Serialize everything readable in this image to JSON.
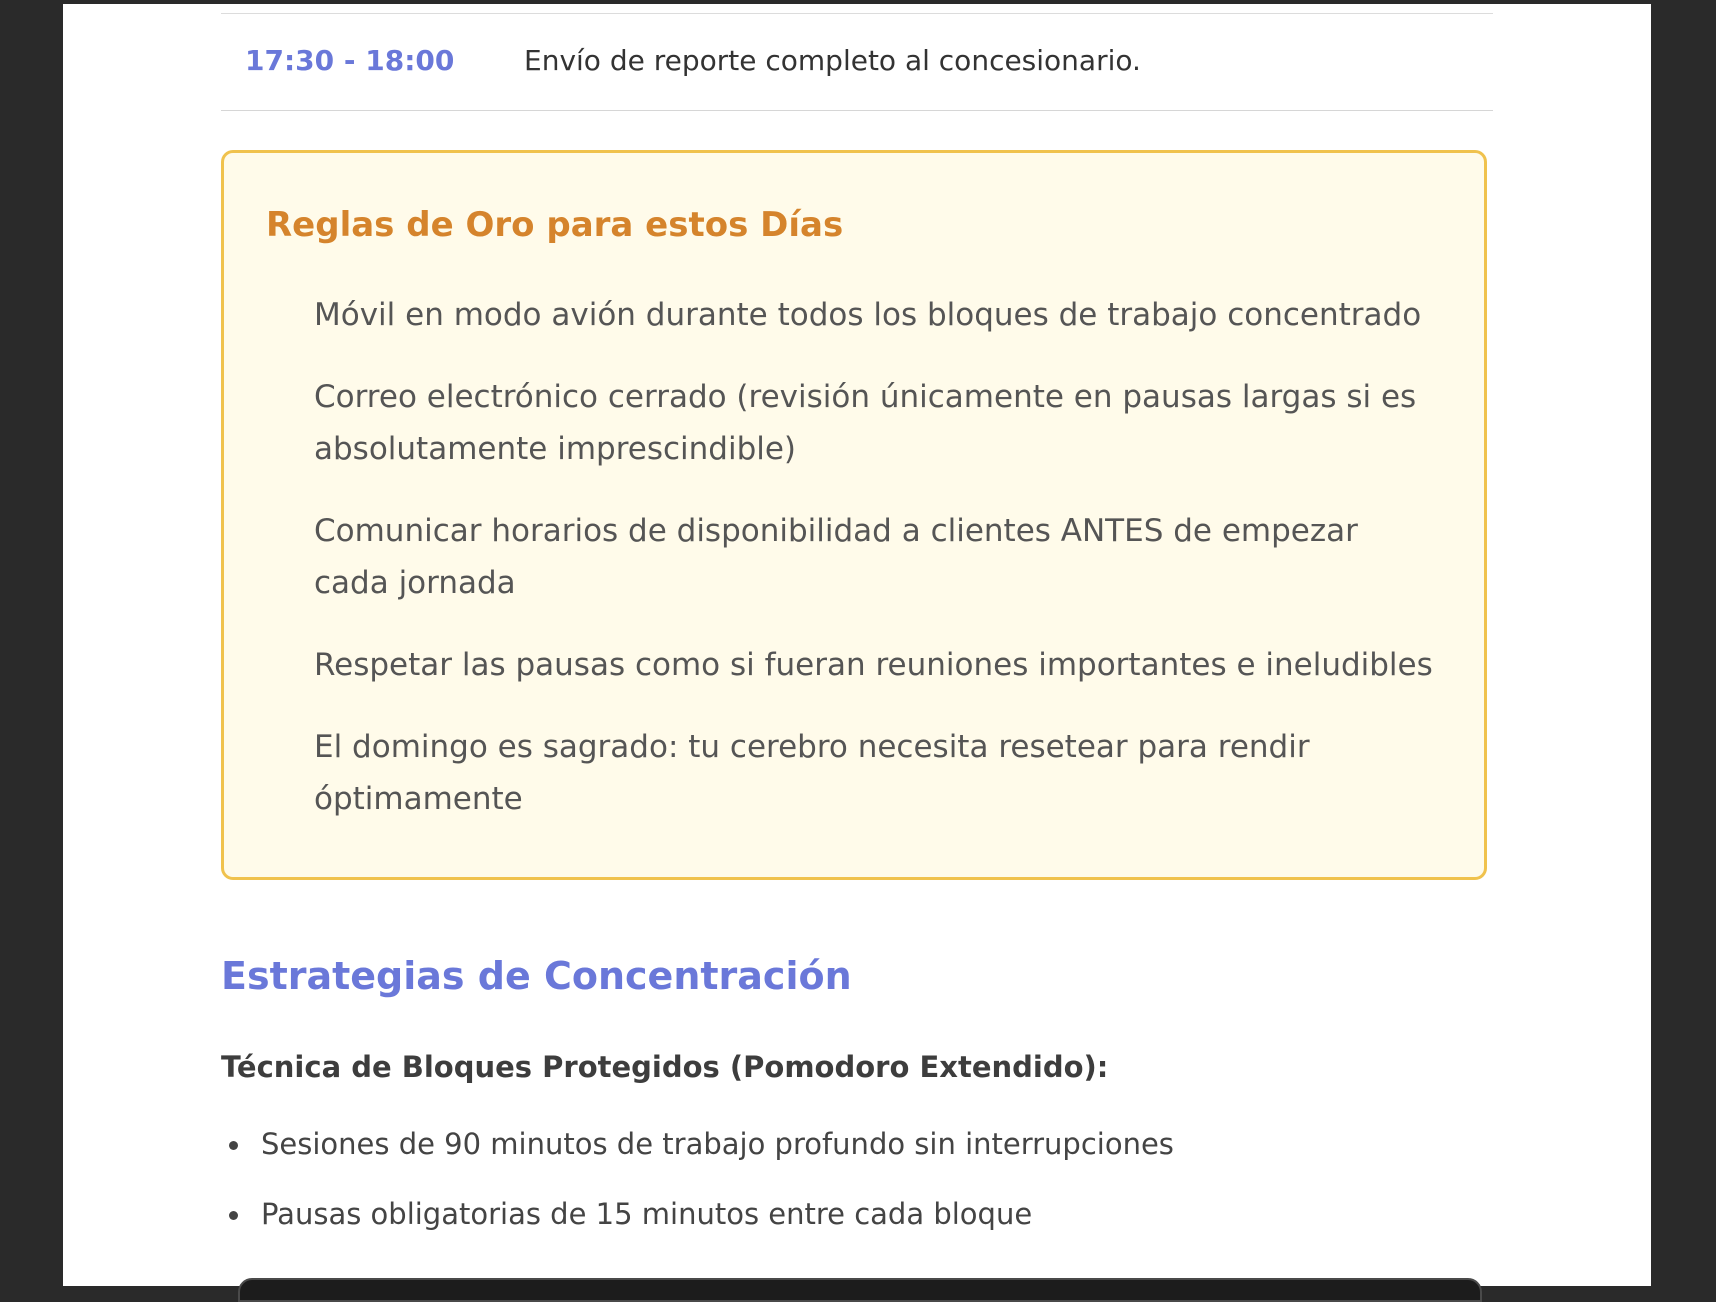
{
  "schedule": {
    "time": "17:30 - 18:00",
    "description": "Envío de reporte completo al concesionario."
  },
  "rules": {
    "title": "Reglas de Oro para estos Días",
    "items": [
      "Móvil en modo avión durante todos los bloques de trabajo concentrado",
      "Correo electrónico cerrado (revisión únicamente en pausas largas si es absolutamente imprescindible)",
      "Comunicar horarios de disponibilidad a clientes ANTES de empezar cada jornada",
      "Respetar las pausas como si fueran reuniones importantes e ineludibles",
      "El domingo es sagrado: tu cerebro necesita resetear para rendir óptimamente"
    ]
  },
  "strategies": {
    "title": "Estrategias de Concentración",
    "subtitle": "Técnica de Bloques Protegidos (Pomodoro Extendido):",
    "bullets": [
      "Sesiones de 90 minutos de trabajo profundo sin interrupciones",
      "Pausas obligatorias de 15 minutos entre cada bloque"
    ]
  }
}
